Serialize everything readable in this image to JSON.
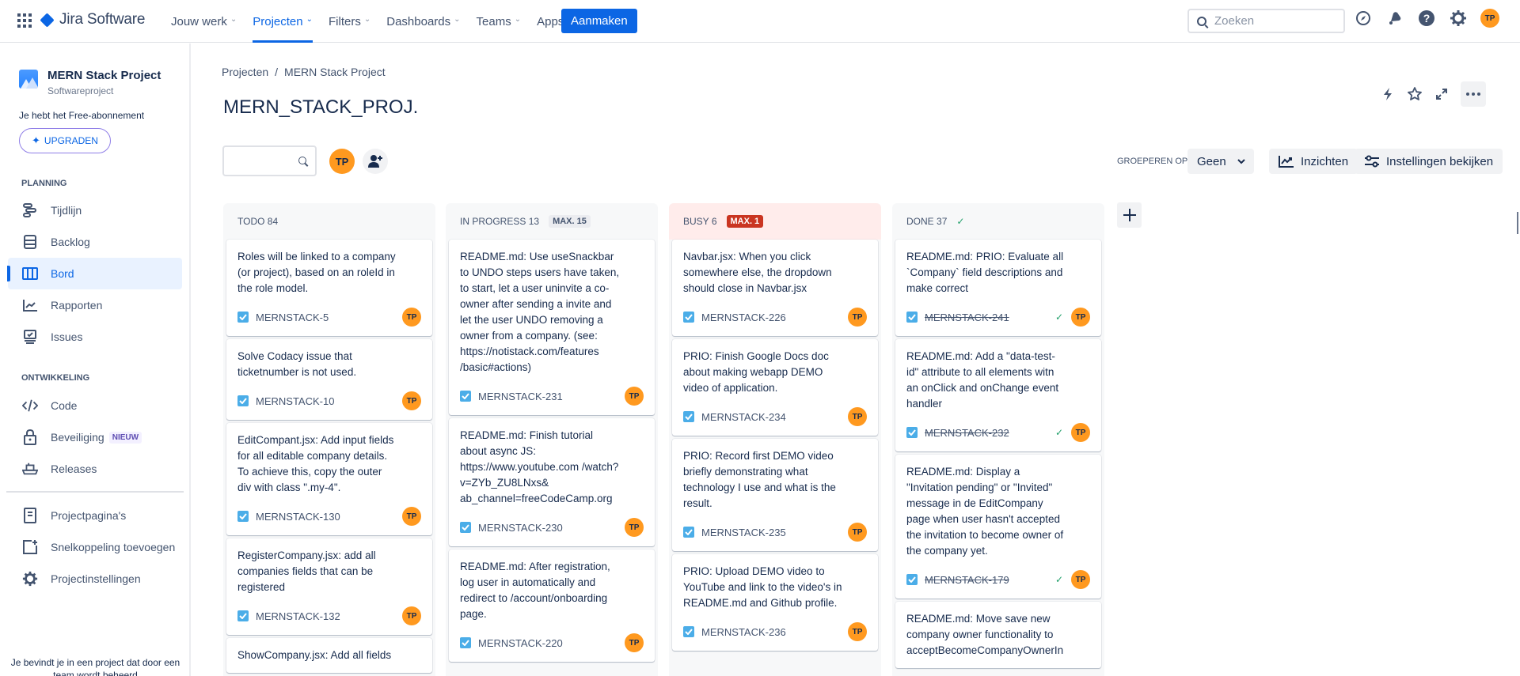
{
  "topnav": {
    "app_name": "Jira Software",
    "items": [
      {
        "label": "Jouw werk",
        "active": false
      },
      {
        "label": "Projecten",
        "active": true
      },
      {
        "label": "Filters",
        "active": false
      },
      {
        "label": "Dashboards",
        "active": false
      },
      {
        "label": "Teams",
        "active": false
      },
      {
        "label": "Apps",
        "active": false
      }
    ],
    "create_label": "Aanmaken",
    "search_placeholder": "Zoeken",
    "icons": [
      "compass-icon",
      "notification-bell-icon",
      "help-icon",
      "settings-gear-icon"
    ],
    "user_initials": "TP"
  },
  "sidebar": {
    "project_name": "MERN Stack Project",
    "project_type": "Softwareproject",
    "plan_text": "Je hebt het Free-abonnement",
    "upgrade_label": "UPGRADEN",
    "planning_label": "PLANNING",
    "planning_items": [
      {
        "label": "Tijdlijn",
        "icon": "timeline-icon"
      },
      {
        "label": "Backlog",
        "icon": "backlog-icon"
      },
      {
        "label": "Bord",
        "icon": "board-icon",
        "active": true
      },
      {
        "label": "Rapporten",
        "icon": "reports-icon"
      },
      {
        "label": "Issues",
        "icon": "issues-icon"
      }
    ],
    "development_label": "ONTWIKKELING",
    "development_items": [
      {
        "label": "Code",
        "icon": "code-icon"
      },
      {
        "label": "Beveiliging",
        "icon": "lock-icon",
        "badge": "NIEUW"
      },
      {
        "label": "Releases",
        "icon": "ship-icon"
      }
    ],
    "extra_items": [
      {
        "label": "Projectpagina's",
        "icon": "page-icon"
      },
      {
        "label": "Snelkoppeling toevoegen",
        "icon": "add-shortcut-icon"
      },
      {
        "label": "Projectinstellingen",
        "icon": "gear-icon"
      }
    ],
    "footer_text": "Je bevindt je in een project dat door een team wordt beheerd"
  },
  "main": {
    "breadcrumb": [
      "Projecten",
      "MERN Stack Project"
    ],
    "breadcrumb_separator": "/",
    "title": "MERN_STACK_PROJ.",
    "board_search_value": "",
    "board_avatar": "TP",
    "group_by_label": "GROEPEREN OP",
    "group_by_value": "Geen",
    "insights_label": "Inzichten",
    "view_settings_label": "Instellingen bekijken"
  },
  "colors": {
    "brand_blue": "#0c66e4",
    "avatar_orange": "#ff991f",
    "over_limit_red": "#ca3521",
    "done_green": "#22a06b",
    "task_blue": "#4bade8"
  },
  "columns": [
    {
      "name": "TODO",
      "count": "84",
      "limit": null,
      "cards": [
        {
          "summary": "Roles will be linked to a company (or project), based on an roleId in the role model.",
          "key": "MERNSTACK-5",
          "assignee": "TP",
          "done": false
        },
        {
          "summary": "Solve Codacy issue that ticketnumber is not used.",
          "key": "MERNSTACK-10",
          "assignee": "TP",
          "done": false
        },
        {
          "summary": "EditCompant.jsx: Add input fields for all editable company details. To achieve this, copy the outer div with class \".my-4\".",
          "key": "MERNSTACK-130",
          "assignee": "TP",
          "done": false
        },
        {
          "summary": "RegisterCompany.jsx: add all companies fields that can be registered",
          "key": "MERNSTACK-132",
          "assignee": "TP",
          "done": false
        },
        {
          "summary": "ShowCompany.jsx: Add all fields",
          "key": "",
          "assignee": "",
          "done": false
        }
      ]
    },
    {
      "name": "IN PROGRESS",
      "count": "13",
      "limit": "MAX. 15",
      "over_limit": false,
      "cards": [
        {
          "summary": "README.md: Use useSnackbar to UNDO steps users have taken, to start, let a user uninvite a co-owner after sending a invite and let the user UNDO removing a owner from a company. (see: https://notistack.com/features /basic#actions)",
          "key": "MERNSTACK-231",
          "assignee": "TP",
          "done": false
        },
        {
          "summary": "README.md: Finish tutorial about async JS: https://www.youtube.com /watch?v=ZYb_ZU8LNxs& ab_channel=freeCodeCamp.org",
          "key": "MERNSTACK-230",
          "assignee": "TP",
          "done": false
        },
        {
          "summary": "README.md: After registration, log user in automatically and redirect to /account/onboarding page.",
          "key": "MERNSTACK-220",
          "assignee": "TP",
          "done": false
        }
      ]
    },
    {
      "name": "BUSY",
      "count": "6",
      "limit": "MAX. 1",
      "over_limit": true,
      "cards": [
        {
          "summary": "Navbar.jsx: When you click somewhere else, the dropdown should close in Navbar.jsx",
          "key": "MERNSTACK-226",
          "assignee": "TP",
          "done": false
        },
        {
          "summary": "PRIO: Finish Google Docs doc about making webapp DEMO video of application.",
          "key": "MERNSTACK-234",
          "assignee": "TP",
          "done": false
        },
        {
          "summary": "PRIO: Record first DEMO video briefly demonstrating what technology I use and what is the result.",
          "key": "MERNSTACK-235",
          "assignee": "TP",
          "done": false
        },
        {
          "summary": "PRIO: Upload DEMO video to YouTube and link to the video's in README.md and Github profile.",
          "key": "MERNSTACK-236",
          "assignee": "TP",
          "done": false
        }
      ]
    },
    {
      "name": "DONE",
      "count": "37",
      "limit": null,
      "complete": true,
      "cards": [
        {
          "summary": "README.md: PRIO: Evaluate all `Company` field descriptions and make correct",
          "key": "MERNSTACK-241",
          "assignee": "TP",
          "done": true
        },
        {
          "summary": "README.md: Add a \"data-test-id\" attribute to all elements witn an onClick and onChange event handler",
          "key": "MERNSTACK-232",
          "assignee": "TP",
          "done": true
        },
        {
          "summary": "README.md: Display a \"Invitation pending\" or \"Invited\" message in de EditCompany page when user hasn't accepted the invitation to become owner of the company yet.",
          "key": "MERNSTACK-179",
          "assignee": "TP",
          "done": true
        },
        {
          "summary": "README.md: Move save new company owner functionality to acceptBecomeCompanyOwnerIn",
          "key": "",
          "assignee": "",
          "done": true
        }
      ]
    }
  ]
}
